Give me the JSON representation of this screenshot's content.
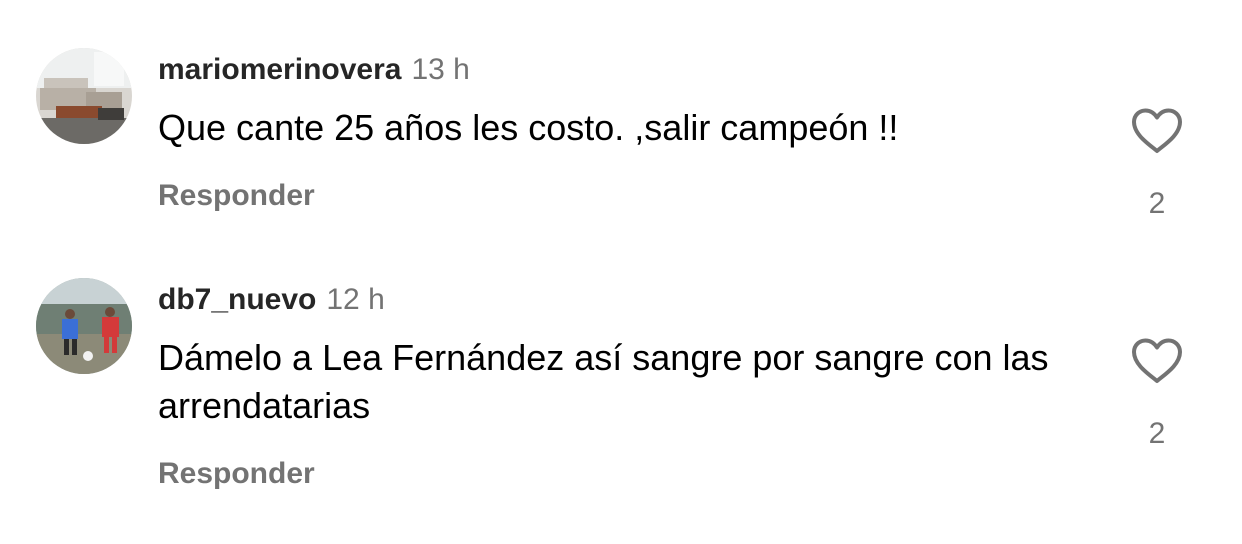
{
  "comments": [
    {
      "username": "mariomerinovera",
      "time": "13 h",
      "text": "Que cante 25 años les costo. ,salir campeón !!",
      "reply_label": "Responder",
      "like_icon": "heart-outline-icon",
      "like_count": "2"
    },
    {
      "username": "db7_nuevo",
      "time": "12 h",
      "text": "Dámelo a Lea Fernández así sangre por sangre con las arrendatarias",
      "reply_label": "Responder",
      "like_icon": "heart-outline-icon",
      "like_count": "2"
    }
  ],
  "colors": {
    "username": "#262626",
    "secondary": "#737373",
    "text": "#000000",
    "background": "#ffffff"
  }
}
